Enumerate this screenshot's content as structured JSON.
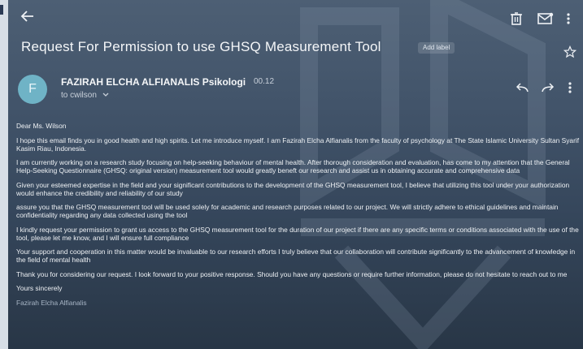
{
  "email": {
    "subject": "Request For Permission to use GHSQ Measurement Tool",
    "label_chip": "Add label",
    "sender": {
      "avatar_letter": "F",
      "name": "FAZIRAH ELCHA ALFIANALIS Psikologi",
      "time": "00.12",
      "to": "to cwilson"
    },
    "body": {
      "greeting": "Dear Ms. Wilson",
      "paragraphs": [
        "I hope this email finds you in good health and high spirits. Let me introduce myself. I am Fazirah Elcha Alfianalis from the faculty of psychology at The State Islamic University Sultan Syarif Kasim Riau, Indonesia.",
        "I am currently working on a research study focusing on help-seeking behaviour of mental health. After thorough consideration and evaluation, has come to my attention that the General Help-Seeking Questionnaire (GHSQ: original version) measurement tool would greatly beneft our research and assist us in obtaining accurate and comprehensive data",
        "Given your esteemed expertise in the field and your significant contributions to the development of the GHSQ measurement tool, I believe that utilizing this tool under your authorization would enhance the credibility and reliability of our study",
        "assure you that the GHSQ measurement tool will be used solely for academic and research purposes related to our project. We will strictly adhere to ethical guidelines and maintain confidentiality regarding any data collected using the tool",
        "I kindly request your permission to grant us access to the GHSQ measurement tool for the duration of our project if there are any specific terms or conditions associated with the use of the tool, please let me know, and I will ensure full compliance",
        "Your support and cooperation in this matter would be invaluable to our research efforts I truly believe that our collaboration will contribute significantly to the advancement of knowledge in the field of mental health",
        "Thank you for considering our request. I look forward to your positive response. Should you have any questions or require further information, please do not hesitate to reach out to me"
      ],
      "closing": "Yours sincerely",
      "signature": "Fazirah Elcha Alfianalis"
    }
  },
  "icons": {
    "back": "arrow-left-icon",
    "delete": "trash-icon",
    "unread": "mail-icon",
    "more": "more-vert-icon",
    "star": "star-icon",
    "reply": "reply-icon",
    "forward": "forward-icon",
    "sender_more": "more-vert-icon"
  },
  "colors": {
    "background_top": "#4d5f74",
    "background_bottom": "#283646",
    "avatar": "#6fb3c6",
    "text": "#eef1f4"
  }
}
